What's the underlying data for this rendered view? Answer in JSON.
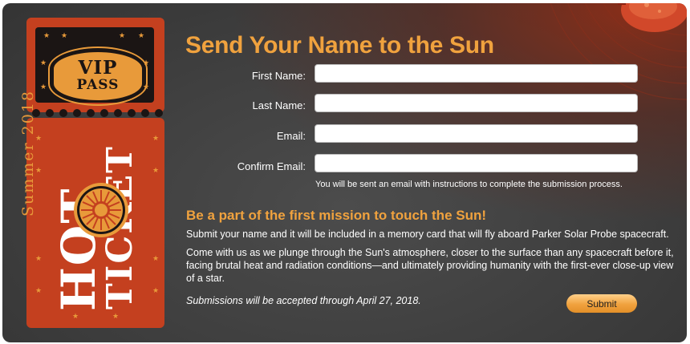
{
  "ticket": {
    "vip_line1": "VIP",
    "vip_line2": "PASS",
    "summer": "Summer 2018",
    "hot": "HOT",
    "ticket_word": "TICKET"
  },
  "form": {
    "title": "Send Your Name to the Sun",
    "fields": [
      {
        "label": "First Name:",
        "value": ""
      },
      {
        "label": "Last Name:",
        "value": ""
      },
      {
        "label": "Email:",
        "value": ""
      },
      {
        "label": "Confirm Email:",
        "value": ""
      }
    ],
    "helper": "You will be sent an email with instructions to complete the submission process.",
    "subhead": "Be a part of the first mission to touch the Sun!",
    "paragraph1": "Submit your name and it will be included in a memory card that will fly aboard Parker Solar Probe spacecraft.",
    "paragraph2": "Come with us as we plunge through the Sun's atmosphere, closer to the surface than any spacecraft before it, facing brutal heat and radiation conditions—and ultimately providing humanity with the first-ever close-up view of a star.",
    "deadline": "Submissions will be accepted through April 27, 2018.",
    "submit_label": "Submit"
  },
  "colors": {
    "accent": "#f0a23e",
    "ticket_red": "#c4401f",
    "background": "#3f3f3f"
  }
}
